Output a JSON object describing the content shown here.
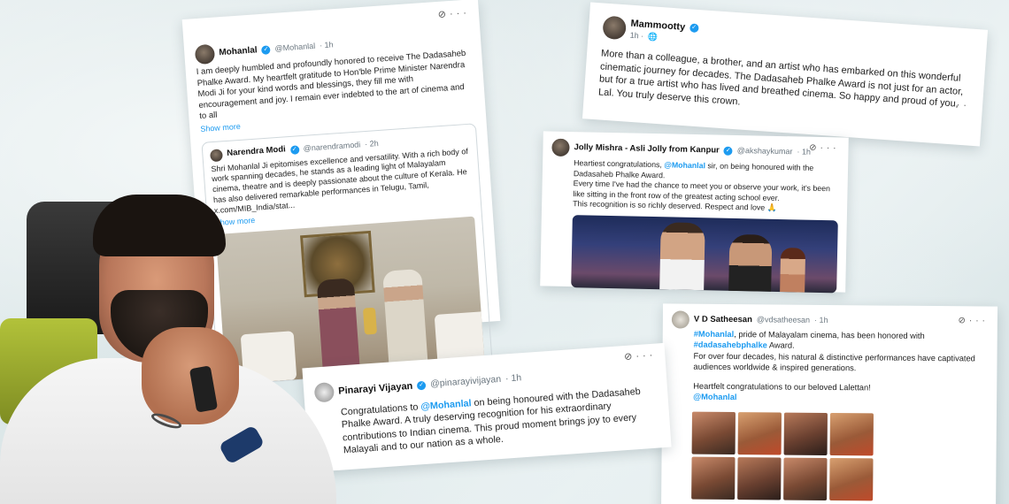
{
  "mohanlal_post": {
    "name": "Mohanlal",
    "handle": "@Mohanlal",
    "time": "· 1h",
    "text": "I am deeply humbled and profoundly honored to receive The Dadasaheb Phalke Award.  My heartfelt gratitude to Hon'ble Prime Minister Narendra Modi Ji for your kind words and blessings, they fill me with encouragement and joy. I remain ever indebted to the art of cinema and to all",
    "show_more": "Show more",
    "quoted": {
      "name": "Narendra Modi",
      "handle": "@narendramodi",
      "time": "· 2h",
      "text": "Shri Mohanlal Ji epitomises excellence and versatility. With a rich body of work spanning decades, he stands as a leading light of Malayalam cinema, theatre and is deeply passionate about the culture of Kerala. He has also delivered remarkable performances in Telugu, Tamil,",
      "link": "x.com/MIB_India/stat...",
      "show_more": "Show more"
    }
  },
  "mammootty_post": {
    "name": "Mammootty",
    "time": "1h ·",
    "text": "More than a colleague, a brother, and an artist who has embarked on this wonderful cinematic journey for decades. The Dadasaheb Phalke Award is not just for an actor, but for a true artist who has lived and breathed cinema. So happy and proud of you, Lal. You truly deserve this crown."
  },
  "jolly_post": {
    "name": "Jolly Mishra - Asli Jolly from Kanpur",
    "handle": "@akshaykumar",
    "time": "· 1h",
    "text_before": "Heartiest congratulations, ",
    "mention": "@Mohanlal",
    "text_after": " sir, on being honoured with the Dadasaheb Phalke Award.",
    "line2": "Every time I've had the chance to meet you or observe your work, it's been like sitting in the front row of the greatest acting school ever.",
    "line3": "This recognition is so richly deserved. Respect and love 🙏"
  },
  "satheesan_post": {
    "name": "V D Satheesan",
    "handle": "@vdsatheesan",
    "time": "· 1h",
    "hashtag1": "#Mohanlal",
    "text1": ", pride of Malayalam cinema, has been honored with",
    "hashtag2": "#dadasahebphalke",
    "text2": " Award.",
    "text3": "For over four decades, his natural & distinctive performances have captivated audiences worldwide & inspired generations.",
    "text4": "Heartfelt congratulations to our beloved Lalettan!",
    "mention": "@Mohanlal"
  },
  "pinarayi_post": {
    "name": "Pinarayi Vijayan",
    "handle": "@pinarayivijayan",
    "time": "· 1h",
    "text_before": "Congratulations to ",
    "mention": "@Mohanlal",
    "text_after": " on being honoured with the Dadasaheb Phalke Award. A truly deserving recognition for his extraordinary contributions to Indian cinema. This proud moment brings joy to every Malayali and to our nation as a whole."
  },
  "icons": {
    "verified": "verified-badge-icon",
    "more": "more-options-icon",
    "grok": "grok-icon",
    "globe": "globe-icon"
  },
  "colors": {
    "link": "#1d9bf0",
    "background": "#dfe9ea"
  }
}
